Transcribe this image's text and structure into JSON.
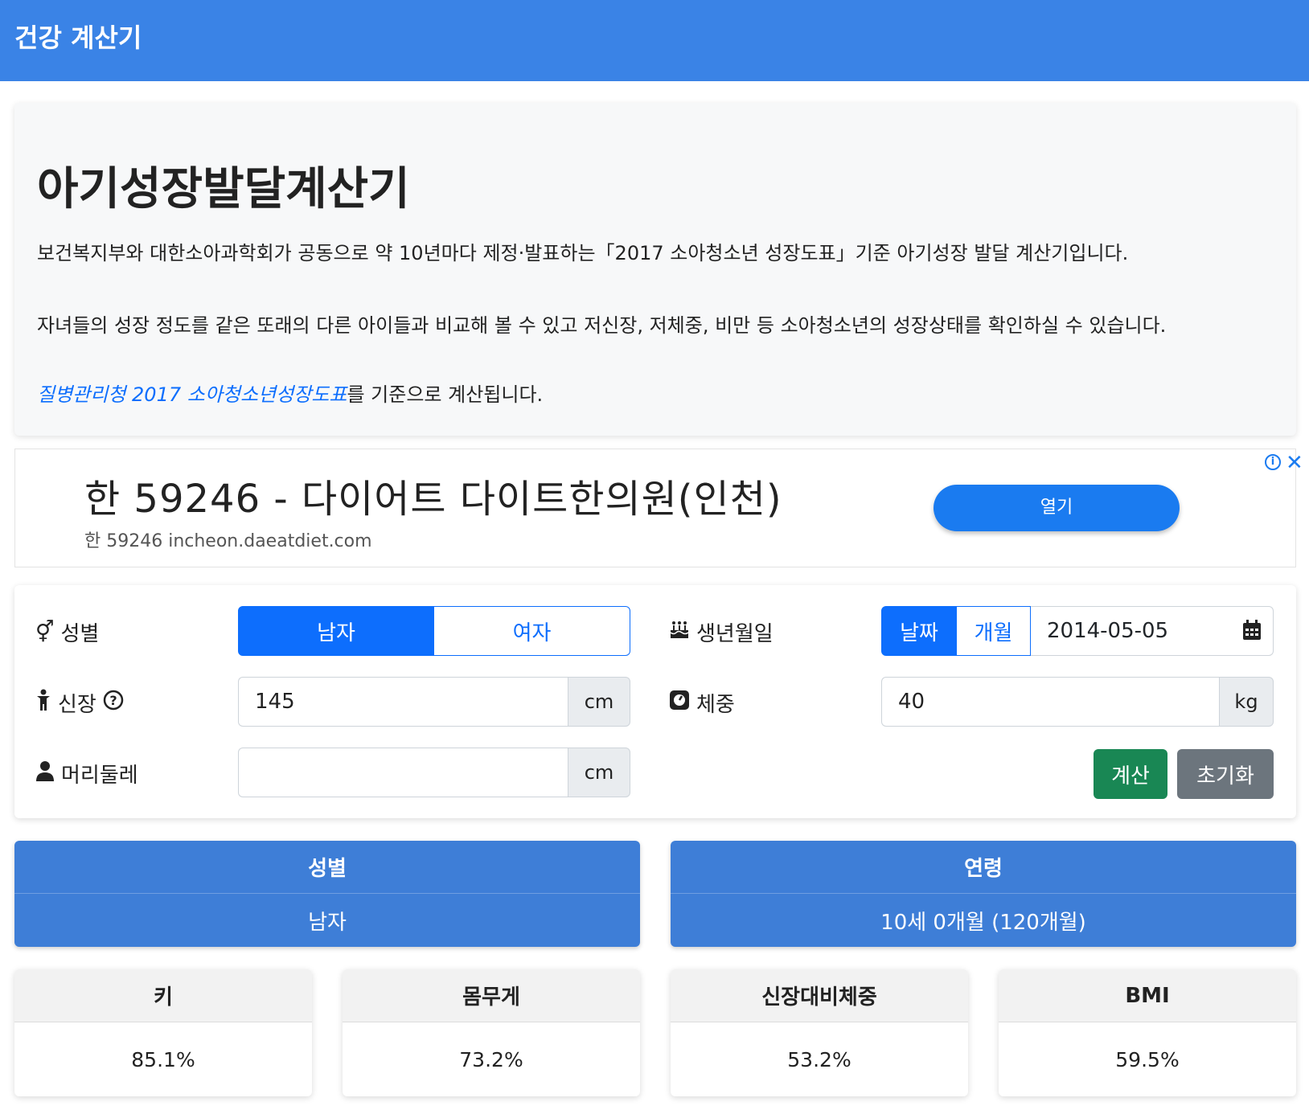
{
  "navbar": {
    "brand": "건강 계산기"
  },
  "intro": {
    "title": "아기성장발달계산기",
    "paragraph1": "보건복지부와 대한소아과학회가 공동으로 약 10년마다 제정·발표하는「2017 소아청소년 성장도표」기준 아기성장 발달 계산기입니다.",
    "paragraph2": "자녀들의 성장 정도를 같은 또래의 다른 아이들과 비교해 볼 수 있고 저신장, 저체중, 비만 등 소아청소년의 성장상태를 확인하실 수 있습니다.",
    "link_text": "질병관리청 2017 소아청소년성장도표",
    "link_suffix": "를 기준으로 계산됩니다."
  },
  "ad": {
    "headline": "한 59246 - 다이어트 다이트한의원(인천)",
    "url": "한 59246 incheon.daeatdiet.com",
    "open_label": "열기",
    "info_icon": "info-icon",
    "close_icon": "close-icon",
    "accent": "#1a7bf0"
  },
  "form": {
    "gender_label": "성별",
    "gender_options": [
      "남자",
      "여자"
    ],
    "gender_selected": "남자",
    "birth_label": "생년월일",
    "birth_mode_options": [
      "날짜",
      "개월"
    ],
    "birth_mode_selected": "날짜",
    "birth_value": "2014-05-05",
    "height_label": "신장",
    "height_value": "145",
    "height_unit": "cm",
    "weight_label": "체중",
    "weight_value": "40",
    "weight_unit": "kg",
    "head_label": "머리둘레",
    "head_value": "",
    "head_unit": "cm",
    "calc_label": "계산",
    "reset_label": "초기화"
  },
  "results": {
    "gender_header": "성별",
    "gender_value": "남자",
    "age_header": "연령",
    "age_value": "10세 0개월 (120개월)"
  },
  "percentiles": [
    {
      "label": "키",
      "value": "85.1%"
    },
    {
      "label": "몸무게",
      "value": "73.2%"
    },
    {
      "label": "신장대비체중",
      "value": "53.2%"
    },
    {
      "label": "BMI",
      "value": "59.5%"
    }
  ],
  "colors": {
    "navbar": "#3a83e6",
    "primary": "#0d6efd",
    "success": "#198754",
    "secondary": "#6c757d",
    "result_card": "#3e7ed7"
  }
}
